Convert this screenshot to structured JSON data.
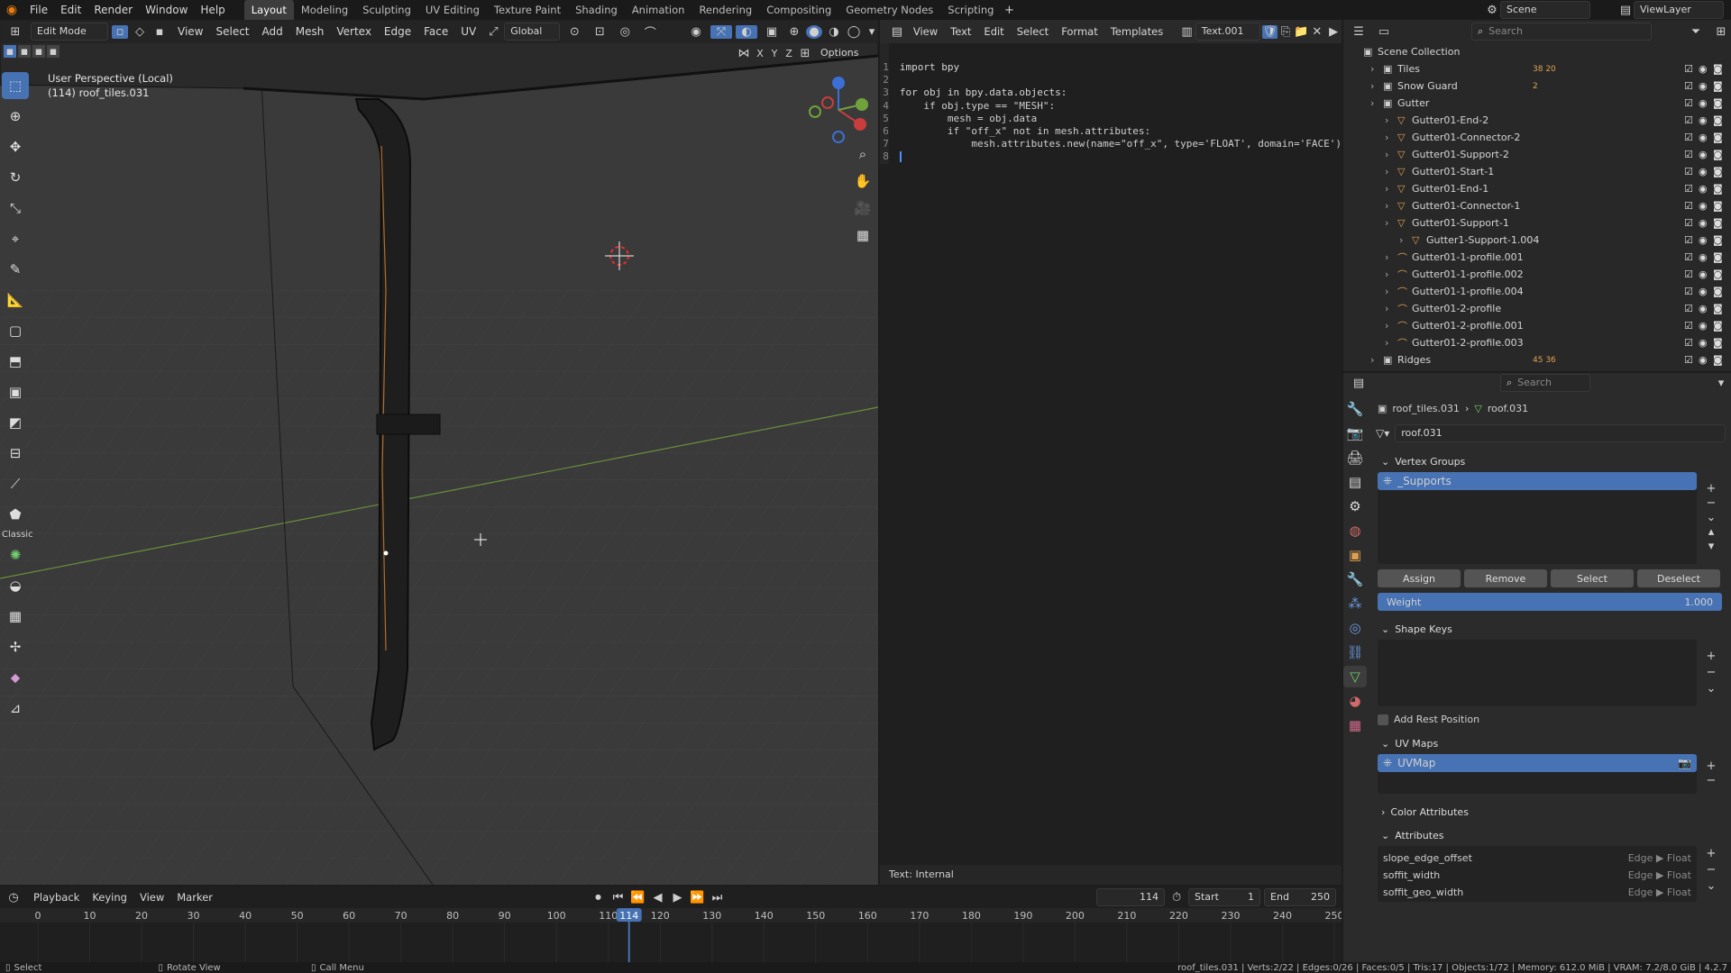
{
  "topbar": {
    "menus": [
      "File",
      "Edit",
      "Render",
      "Window",
      "Help"
    ],
    "workspaces": [
      "Layout",
      "Modeling",
      "Sculpting",
      "UV Editing",
      "Texture Paint",
      "Shading",
      "Animation",
      "Rendering",
      "Compositing",
      "Geometry Nodes",
      "Scripting"
    ],
    "active_workspace": "Layout",
    "scene": "Scene",
    "view_layer": "ViewLayer"
  },
  "viewport": {
    "mode": "Edit Mode",
    "menus": [
      "View",
      "Select",
      "Add",
      "Mesh",
      "Vertex",
      "Edge",
      "Face",
      "UV"
    ],
    "transform": "Global",
    "axes": [
      "X",
      "Y",
      "Z"
    ],
    "options": "Options",
    "overlay_title": "User Perspective (Local)",
    "overlay_object": "(114) roof_tiles.031",
    "classic_label": "Classic"
  },
  "text_editor": {
    "menus": [
      "View",
      "Text",
      "Edit",
      "Select",
      "Format",
      "Templates"
    ],
    "filename": "Text.001",
    "footer": "Text: Internal",
    "lines": [
      {
        "n": "1",
        "t": "import bpy"
      },
      {
        "n": "2",
        "t": ""
      },
      {
        "n": "3",
        "t": "for obj in bpy.data.objects:"
      },
      {
        "n": "4",
        "t": "    if obj.type == \"MESH\":"
      },
      {
        "n": "5",
        "t": "        mesh = obj.data"
      },
      {
        "n": "6",
        "t": "        if \"off_x\" not in mesh.attributes:"
      },
      {
        "n": "7",
        "t": "            mesh.attributes.new(name=\"off_x\", type='FLOAT', domain='FACE')"
      },
      {
        "n": "8",
        "t": ""
      }
    ]
  },
  "outliner": {
    "search_placeholder": "Search",
    "root": "Scene Collection",
    "items": [
      {
        "label": "Tiles",
        "indent": 1,
        "type": "collection",
        "extra": "38 20"
      },
      {
        "label": "Snow Guard",
        "indent": 1,
        "type": "collection",
        "extra": "2"
      },
      {
        "label": "Gutter",
        "indent": 1,
        "type": "collection",
        "extra": ""
      },
      {
        "label": "Gutter01-End-2",
        "indent": 2,
        "type": "mesh",
        "extra": ""
      },
      {
        "label": "Gutter01-Connector-2",
        "indent": 2,
        "type": "mesh",
        "extra": ""
      },
      {
        "label": "Gutter01-Support-2",
        "indent": 2,
        "type": "mesh",
        "extra": ""
      },
      {
        "label": "Gutter01-Start-1",
        "indent": 2,
        "type": "mesh",
        "extra": ""
      },
      {
        "label": "Gutter01-End-1",
        "indent": 2,
        "type": "mesh",
        "extra": ""
      },
      {
        "label": "Gutter01-Connector-1",
        "indent": 2,
        "type": "mesh",
        "extra": ""
      },
      {
        "label": "Gutter01-Support-1",
        "indent": 2,
        "type": "mesh",
        "extra": ""
      },
      {
        "label": "Gutter1-Support-1.004",
        "indent": 3,
        "type": "mesh",
        "extra": ""
      },
      {
        "label": "Gutter01-1-profile.001",
        "indent": 2,
        "type": "curve",
        "extra": ""
      },
      {
        "label": "Gutter01-1-profile.002",
        "indent": 2,
        "type": "curve",
        "extra": ""
      },
      {
        "label": "Gutter01-1-profile.004",
        "indent": 2,
        "type": "curve",
        "extra": ""
      },
      {
        "label": "Gutter01-2-profile",
        "indent": 2,
        "type": "curve",
        "extra": ""
      },
      {
        "label": "Gutter01-2-profile.001",
        "indent": 2,
        "type": "curve",
        "extra": ""
      },
      {
        "label": "Gutter01-2-profile.003",
        "indent": 2,
        "type": "curve",
        "extra": ""
      },
      {
        "label": "Ridges",
        "indent": 1,
        "type": "collection",
        "extra": "45 36"
      }
    ]
  },
  "properties": {
    "search_placeholder": "Search",
    "breadcrumb_object": "roof_tiles.031",
    "breadcrumb_data": "roof.031",
    "data_name": "roof.031",
    "vertex_groups_title": "Vertex Groups",
    "vertex_group": "_Supports",
    "buttons": [
      "Assign",
      "Remove",
      "Select",
      "Deselect"
    ],
    "weight_label": "Weight",
    "weight_value": "1.000",
    "shape_keys_title": "Shape Keys",
    "add_rest_position": "Add Rest Position",
    "uv_maps_title": "UV Maps",
    "uv_map": "UVMap",
    "color_attributes_title": "Color Attributes",
    "attributes_title": "Attributes",
    "attributes": [
      {
        "name": "slope_edge_offset",
        "domain": "Edge ▶ Float"
      },
      {
        "name": "soffit_width",
        "domain": "Edge ▶ Float"
      },
      {
        "name": "soffit_geo_width",
        "domain": "Edge ▶ Float"
      }
    ]
  },
  "timeline": {
    "menus": [
      "Playback",
      "Keying",
      "View",
      "Marker"
    ],
    "current_frame": "114",
    "start_label": "Start",
    "start": "1",
    "end_label": "End",
    "end": "250",
    "ticks": [
      "0",
      "10",
      "20",
      "30",
      "40",
      "50",
      "60",
      "70",
      "80",
      "90",
      "100",
      "110",
      "120",
      "130",
      "140",
      "150",
      "160",
      "170",
      "180",
      "190",
      "200",
      "210",
      "220",
      "230",
      "240",
      "250"
    ]
  },
  "status": {
    "left": "Select",
    "mid": "Rotate View",
    "right": "Call Menu",
    "stats": "roof_tiles.031 | Verts:2/22 | Edges:0/26 | Faces:0/5 | Tris:17 | Objects:1/72 | Memory: 612.0 MiB | VRAM: 7.2/8.0 GiB | 4.2.7"
  }
}
